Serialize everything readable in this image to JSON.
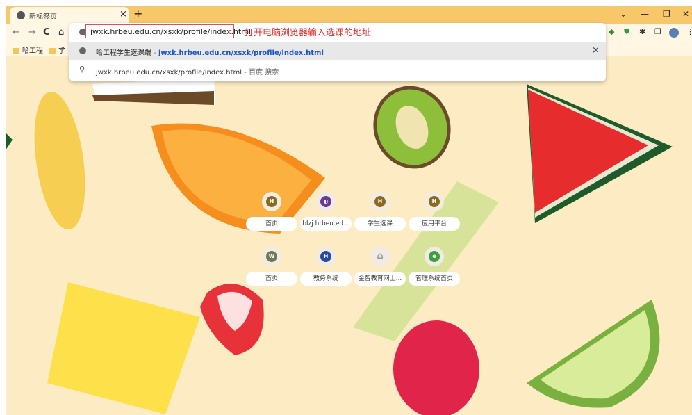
{
  "tab": {
    "title": "新标签页",
    "close": "×",
    "new_tab": "+"
  },
  "window_controls": {
    "menu": "⌄",
    "minimize": "—",
    "restore": "❐",
    "close": "✕"
  },
  "toolbar": {
    "back": "←",
    "forward": "→",
    "reload": "C",
    "home": "⌂"
  },
  "address": {
    "value": "jwxk.hrbeu.edu.cn/xsxk/profile/index.html"
  },
  "annotation": "打开电脑浏览器输入选课的地址",
  "suggestions": [
    {
      "title": "哈工程学生选课端",
      "sep": " - ",
      "url": "jwxk.hrbeu.edu.cn/xsxk/profile/index.html",
      "close": "×"
    },
    {
      "query": "jwxk.hrbeu.edu.cn/xsxk/profile/index.html",
      "suffix": " - 百度 搜索"
    }
  ],
  "bookmarks": [
    {
      "label": "哈工程"
    },
    {
      "label": "学"
    }
  ],
  "shortcuts": [
    {
      "label": "首页",
      "glyph": "H",
      "color": "#8a6a1c"
    },
    {
      "label": "blzj.hrbeu.ed...",
      "glyph": "◐",
      "color": "#6a3a9a"
    },
    {
      "label": "学生选课",
      "glyph": "H",
      "color": "#8a6a1c"
    },
    {
      "label": "应用平台",
      "glyph": "H",
      "color": "#8a6a1c"
    },
    {
      "label": "首页",
      "glyph": "W",
      "color": "#6d7a55"
    },
    {
      "label": "教务系统",
      "glyph": "H",
      "color": "#2a4aa0"
    },
    {
      "label": "金智教育网上...",
      "glyph": "⌂",
      "color": "#aaaaaa"
    },
    {
      "label": "管理系统首页",
      "glyph": "e",
      "color": "#3aa040"
    }
  ]
}
